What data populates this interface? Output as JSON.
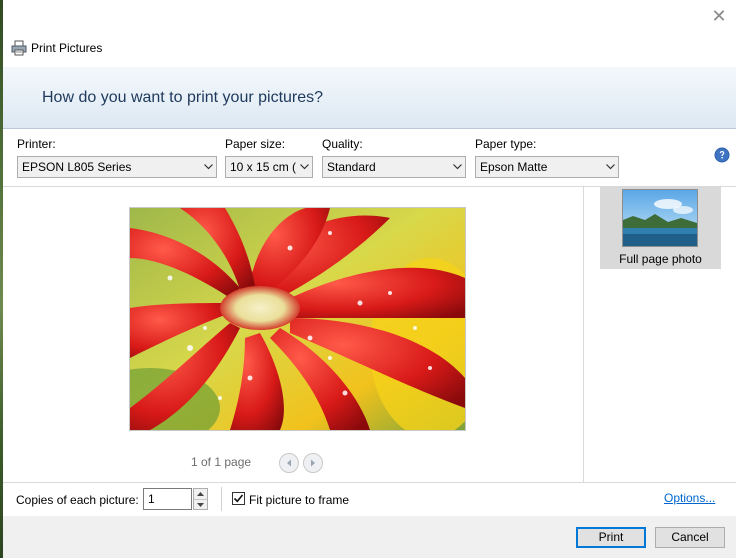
{
  "window": {
    "title": "Print Pictures",
    "close_icon": "close-icon"
  },
  "banner": {
    "heading": "How do you want to print your pictures?"
  },
  "controls": {
    "printer": {
      "label": "Printer:",
      "value": "EPSON L805 Series"
    },
    "paper_size": {
      "label": "Paper size:",
      "value": "10 x 15 cm (4"
    },
    "quality": {
      "label": "Quality:",
      "value": "Standard"
    },
    "paper_type": {
      "label": "Paper type:",
      "value": "Epson Matte"
    },
    "help_icon": "help-icon"
  },
  "preview": {
    "page_count": "1 of 1 page",
    "image": "red-gerbera-photo"
  },
  "layouts": {
    "items": [
      {
        "label": "Full page photo",
        "selected": true
      }
    ]
  },
  "bottom": {
    "copies_label": "Copies of each picture:",
    "copies_value": "1",
    "fit_label": "Fit picture to frame",
    "fit_checked": true,
    "options_link": "Options..."
  },
  "footer": {
    "print_label": "Print",
    "cancel_label": "Cancel"
  },
  "colors": {
    "accent": "#0078d7",
    "banner_text": "#1e395b",
    "link": "#0066cc"
  }
}
